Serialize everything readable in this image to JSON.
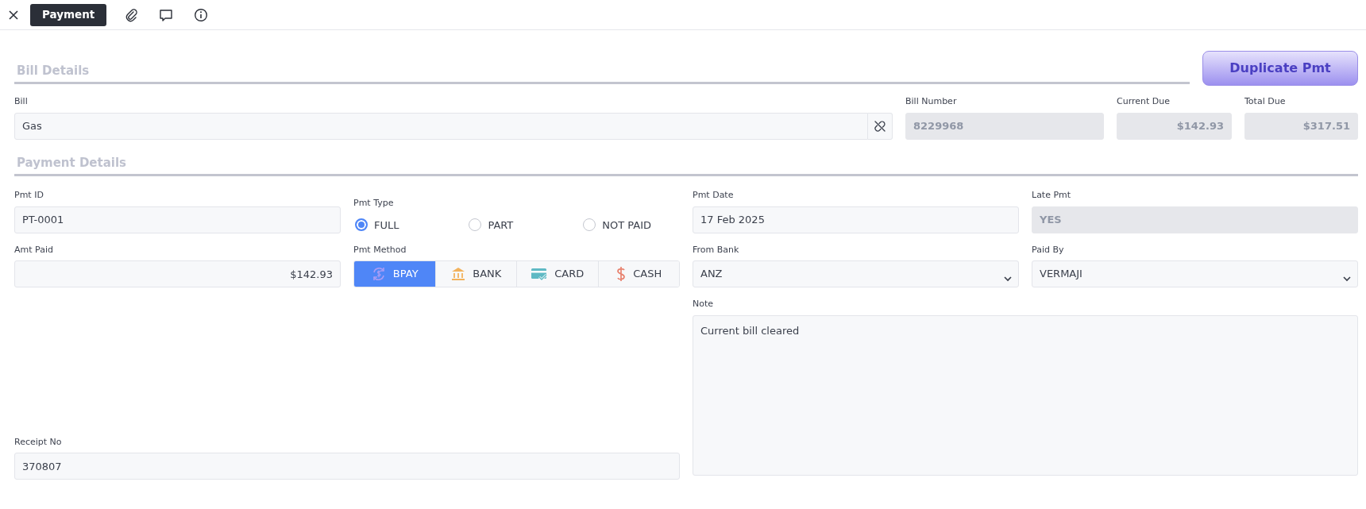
{
  "tabs": [
    {
      "label": "Payment",
      "selected": true
    }
  ],
  "bill_details": {
    "heading": "Bill Details",
    "duplicate_button": "Duplicate Pmt",
    "fields": [
      {
        "label": "Bill",
        "value": "Gas",
        "kind": "linked",
        "disabled": false
      },
      {
        "label": "Bill Number",
        "value": "8229968",
        "kind": "text",
        "disabled": true
      },
      {
        "label": "Current Due",
        "value": "$142.93",
        "kind": "money",
        "disabled": true
      },
      {
        "label": "Total Due",
        "value": "$317.51",
        "kind": "money",
        "disabled": true
      }
    ]
  },
  "payment_details": {
    "heading": "Payment Details",
    "fields": [
      {
        "label": "Pmt ID",
        "value": "PT-0001",
        "kind": "text",
        "disabled": false
      },
      {
        "label": "Pmt Type",
        "kind": "radio",
        "options": [
          {
            "label": "FULL",
            "selected": true
          },
          {
            "label": "PART",
            "selected": false
          },
          {
            "label": "NOT PAID",
            "selected": false
          }
        ]
      },
      {
        "label": "Pmt Date",
        "value": "17 Feb 2025",
        "kind": "text",
        "disabled": false
      },
      {
        "label": "Late Pmt",
        "value": "YES",
        "kind": "text",
        "disabled": true
      },
      {
        "label": "Amt Paid",
        "value": "$142.93",
        "kind": "money",
        "disabled": false
      },
      {
        "label": "Pmt Method",
        "kind": "methods",
        "options": [
          {
            "label": "BPAY",
            "kind": "bpay",
            "selected": true
          },
          {
            "label": "BANK",
            "kind": "bank",
            "selected": false
          },
          {
            "label": "CARD",
            "kind": "card",
            "selected": false
          },
          {
            "label": "CASH",
            "kind": "cash",
            "selected": false
          }
        ]
      },
      {
        "label": "From Bank",
        "value": "ANZ",
        "kind": "select",
        "disabled": false
      },
      {
        "label": "Paid By",
        "value": "VERMAJI",
        "kind": "select",
        "disabled": false
      },
      {
        "label": "Note",
        "value": "Current bill cleared",
        "kind": "note",
        "disabled": false
      },
      {
        "label": "Receipt No",
        "value": "370807",
        "kind": "text",
        "disabled": false
      }
    ]
  }
}
